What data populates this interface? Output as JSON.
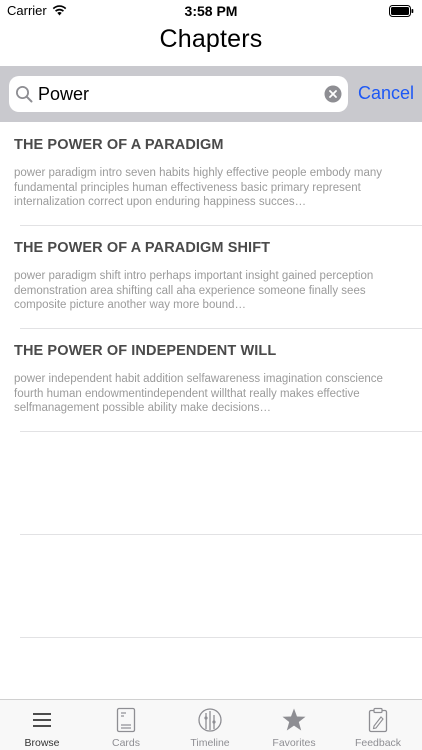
{
  "status_bar": {
    "carrier": "Carrier",
    "time": "3:58 PM"
  },
  "nav": {
    "title": "Chapters"
  },
  "search": {
    "value": "Power",
    "cancel_label": "Cancel"
  },
  "results": [
    {
      "title": "THE POWER OF A PARADIGM",
      "snippet": "power paradigm intro seven habits highly effective people embody many fundamental principles human effectiveness basic primary represent internalization correct upon enduring happiness succes…"
    },
    {
      "title": "THE POWER OF A PARADIGM SHIFT",
      "snippet": "power paradigm shift intro perhaps important insight gained perception demonstration area shifting call aha experience someone finally sees composite picture another way more bound…"
    },
    {
      "title": "THE POWER OF INDEPENDENT WILL",
      "snippet": "power independent habit addition selfawareness imagination conscience fourth human endowmentindependent willthat really makes effective selfmanagement possible ability make decisions…"
    }
  ],
  "tab_bar": {
    "tabs": [
      {
        "label": "Browse",
        "icon": "list-icon",
        "active": true
      },
      {
        "label": "Cards",
        "icon": "cards-icon",
        "active": false
      },
      {
        "label": "Timeline",
        "icon": "timeline-icon",
        "active": false
      },
      {
        "label": "Favorites",
        "icon": "star-icon",
        "active": false
      },
      {
        "label": "Feedback",
        "icon": "feedback-icon",
        "active": false
      }
    ]
  },
  "colors": {
    "accent": "#1d58f5",
    "search_bar_bg": "#c9c9ce",
    "title_text": "#4a4a4a",
    "snippet_text": "#9b9b9b"
  }
}
